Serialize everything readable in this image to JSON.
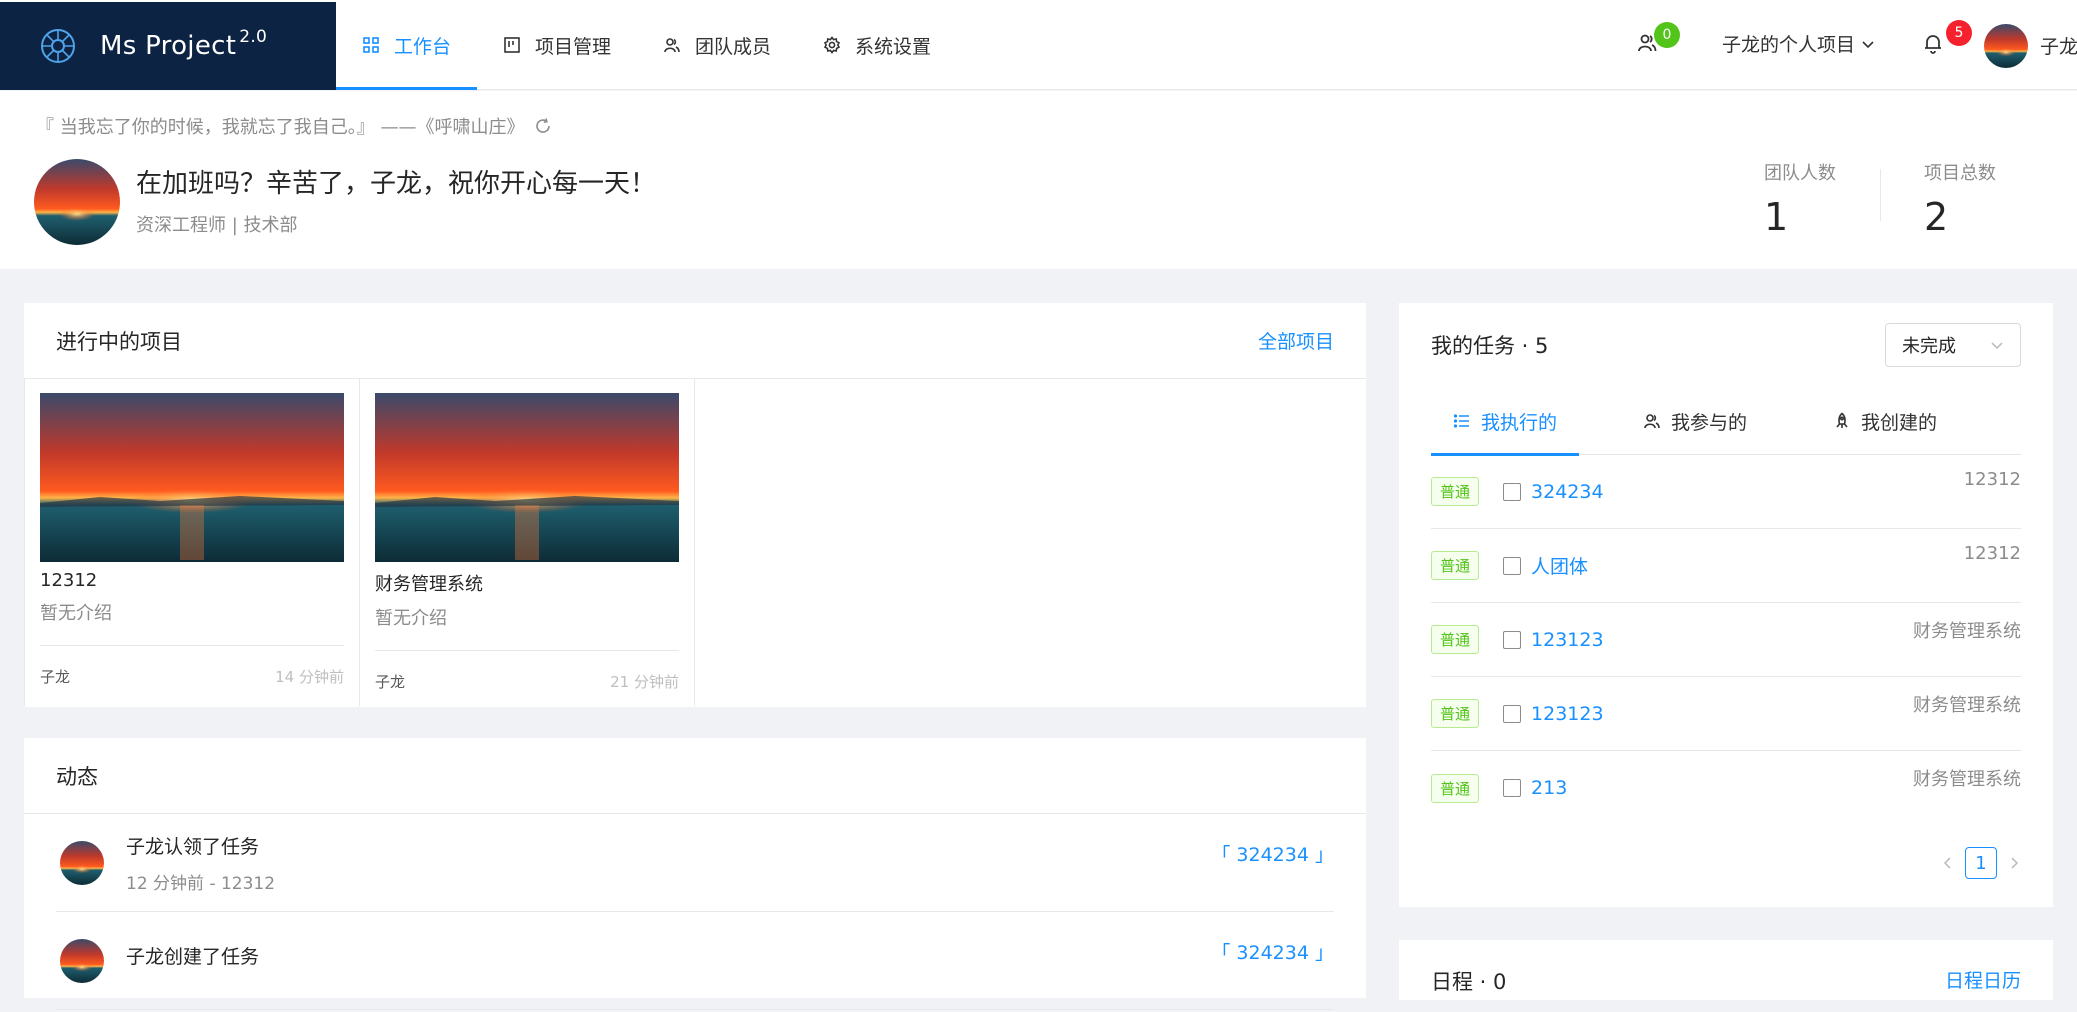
{
  "app": {
    "logo_text": "Ms Project",
    "version": "2.0"
  },
  "nav": [
    {
      "id": "workbench",
      "label": "工作台",
      "icon": "grid-icon",
      "active": true
    },
    {
      "id": "projects",
      "label": "项目管理",
      "icon": "board-icon",
      "active": false
    },
    {
      "id": "members",
      "label": "团队成员",
      "icon": "team-icon",
      "active": false
    },
    {
      "id": "settings",
      "label": "系统设置",
      "icon": "gear-icon",
      "active": false
    }
  ],
  "header": {
    "team_badge": "0",
    "project_switch": "子龙的个人项目",
    "notify_badge": "5",
    "user_name": "子龙"
  },
  "greeting": {
    "quote": "『 当我忘了你的时候，我就忘了我自己。』 ——《呼啸山庄》",
    "title": "在加班吗？辛苦了，子龙，祝你开心每一天！",
    "subtitle": "资深工程师 | 技术部",
    "stats": [
      {
        "label": "团队人数",
        "value": "1"
      },
      {
        "label": "项目总数",
        "value": "2"
      }
    ]
  },
  "projects": {
    "title": "进行中的项目",
    "link": "全部项目",
    "items": [
      {
        "name": "12312",
        "desc": "暂无介绍",
        "owner": "子龙",
        "time": "14 分钟前"
      },
      {
        "name": "财务管理系统",
        "desc": "暂无介绍",
        "owner": "子龙",
        "time": "21 分钟前"
      }
    ]
  },
  "activity": {
    "title": "动态",
    "items": [
      {
        "title": "子龙认领了任务",
        "meta": "12 分钟前 - 12312",
        "link": "「 324234 」"
      },
      {
        "title": "子龙创建了任务",
        "meta": "",
        "link": "「 324234 」"
      }
    ]
  },
  "tasks": {
    "title": "我的任务 · 5",
    "filter": "未完成",
    "tabs": [
      {
        "label": "我执行的",
        "icon": "list-icon",
        "active": true
      },
      {
        "label": "我参与的",
        "icon": "team-icon",
        "active": false
      },
      {
        "label": "我创建的",
        "icon": "rocket-icon",
        "active": false
      }
    ],
    "items": [
      {
        "tag": "普通",
        "name": "324234",
        "project": "12312"
      },
      {
        "tag": "普通",
        "name": "人团体",
        "project": "12312"
      },
      {
        "tag": "普通",
        "name": "123123",
        "project": "财务管理系统"
      },
      {
        "tag": "普通",
        "name": "123123",
        "project": "财务管理系统"
      },
      {
        "tag": "普通",
        "name": "213",
        "project": "财务管理系统"
      }
    ],
    "page": "1"
  },
  "schedule": {
    "title": "日程 · 0",
    "link": "日程日历"
  }
}
